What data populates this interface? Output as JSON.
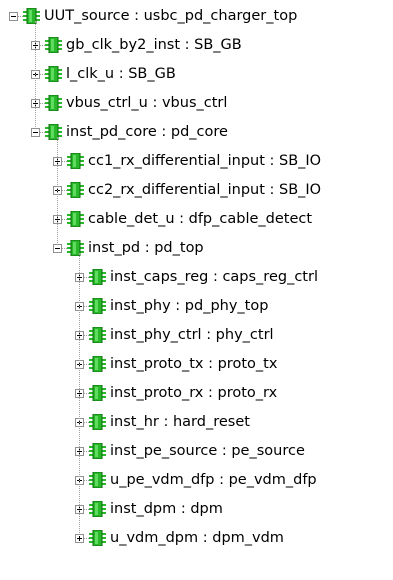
{
  "hierarchy_tree": {
    "nodes": [
      {
        "label": "UUT_source : usbc_pd_charger_top",
        "depth": 0,
        "state": "expanded"
      },
      {
        "label": "gb_clk_by2_inst : SB_GB",
        "depth": 1,
        "state": "collapsed"
      },
      {
        "label": "l_clk_u : SB_GB",
        "depth": 1,
        "state": "collapsed"
      },
      {
        "label": "vbus_ctrl_u : vbus_ctrl",
        "depth": 1,
        "state": "collapsed"
      },
      {
        "label": "inst_pd_core : pd_core",
        "depth": 1,
        "state": "expanded"
      },
      {
        "label": "cc1_rx_differential_input : SB_IO",
        "depth": 2,
        "state": "collapsed"
      },
      {
        "label": "cc2_rx_differential_input : SB_IO",
        "depth": 2,
        "state": "collapsed"
      },
      {
        "label": "cable_det_u : dfp_cable_detect",
        "depth": 2,
        "state": "collapsed"
      },
      {
        "label": "inst_pd : pd_top",
        "depth": 2,
        "state": "expanded"
      },
      {
        "label": "inst_caps_reg : caps_reg_ctrl",
        "depth": 3,
        "state": "collapsed"
      },
      {
        "label": "inst_phy : pd_phy_top",
        "depth": 3,
        "state": "collapsed"
      },
      {
        "label": "inst_phy_ctrl : phy_ctrl",
        "depth": 3,
        "state": "collapsed"
      },
      {
        "label": "inst_proto_tx : proto_tx",
        "depth": 3,
        "state": "collapsed"
      },
      {
        "label": "inst_proto_rx : proto_rx",
        "depth": 3,
        "state": "collapsed"
      },
      {
        "label": "inst_hr : hard_reset",
        "depth": 3,
        "state": "collapsed"
      },
      {
        "label": "inst_pe_source : pe_source",
        "depth": 3,
        "state": "collapsed"
      },
      {
        "label": "u_pe_vdm_dfp : pe_vdm_dfp",
        "depth": 3,
        "state": "collapsed"
      },
      {
        "label": "inst_dpm : dpm",
        "depth": 3,
        "state": "collapsed"
      },
      {
        "label": "u_vdm_dpm : dpm_vdm",
        "depth": 3,
        "state": "collapsed"
      }
    ]
  },
  "icon": "module-instance-icon",
  "colors": {
    "icon_green": "#29b829",
    "icon_dark_green": "#0c6a0c",
    "tree_line": "#a0a0a0",
    "expander_border": "#919191",
    "text": "#000000",
    "background": "#ffffff"
  }
}
